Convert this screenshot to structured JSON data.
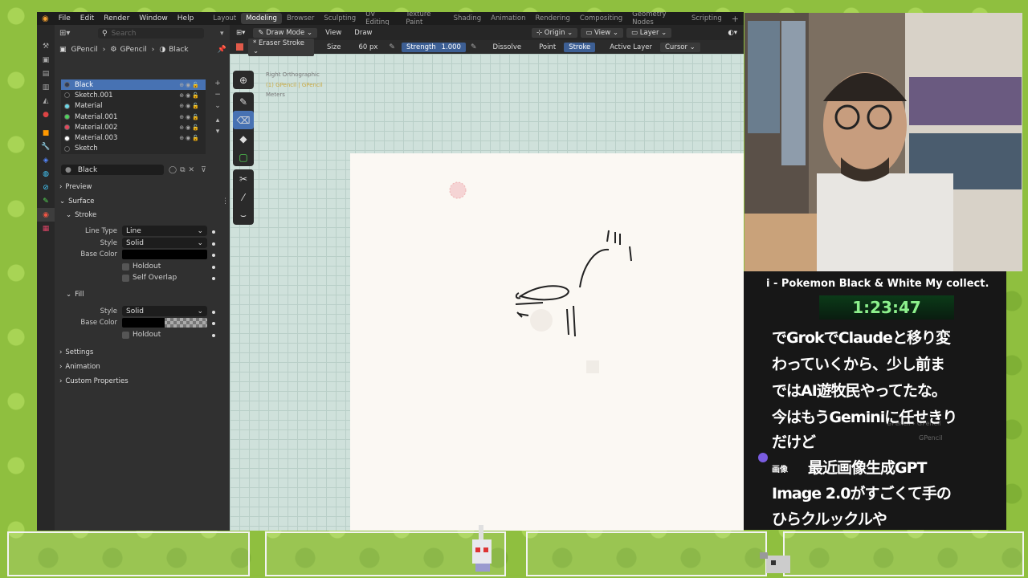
{
  "menu": {
    "file": "File",
    "edit": "Edit",
    "render": "Render",
    "window": "Window",
    "help": "Help"
  },
  "workspaces": [
    "Layout",
    "Modeling",
    "Browser",
    "Sculpting",
    "UV Editing",
    "Texture Paint",
    "Shading",
    "Animation",
    "Rendering",
    "Compositing",
    "Geometry Nodes",
    "Scripting"
  ],
  "props": {
    "search_placeholder": "Search",
    "breadcrumb": [
      "GPencil",
      "GPencil",
      "Black"
    ],
    "materials": [
      {
        "name": "Black",
        "color": "#2e3a55",
        "selected": true
      },
      {
        "name": "Sketch.001",
        "color": "#222222",
        "selected": false
      },
      {
        "name": "Material",
        "color": "#6ad6e6",
        "selected": false
      },
      {
        "name": "Material.001",
        "color": "#4cd45a",
        "selected": false
      },
      {
        "name": "Material.002",
        "color": "#e6465a",
        "selected": false
      },
      {
        "name": "Material.003",
        "color": "#ffffff",
        "selected": false
      },
      {
        "name": "Sketch",
        "color": "#222222",
        "selected": false
      }
    ],
    "material_name": "Black",
    "preview": "Preview",
    "surface": "Surface",
    "stroke": "Stroke",
    "line_type_label": "Line Type",
    "line_type_value": "Line",
    "style_label": "Style",
    "style_value": "Solid",
    "base_color_label": "Base Color",
    "holdout": "Holdout",
    "self_overlap": "Self Overlap",
    "fill": "Fill",
    "fill_style_label": "Style",
    "fill_style_value": "Solid",
    "fill_base_color_label": "Base Color",
    "fill_holdout": "Holdout",
    "settings": "Settings",
    "animation": "Animation",
    "custom_properties": "Custom Properties"
  },
  "viewport": {
    "mode": "Draw Mode",
    "view": "View",
    "draw": "Draw",
    "origin": "Origin",
    "view_dd": "View",
    "layer": "Layer",
    "brush": "Eraser Stroke",
    "size_label": "Size",
    "size_value": "60 px",
    "strength_label": "Strength",
    "strength_value": "1.000",
    "dissolve": "Dissolve",
    "point": "Point",
    "stroke": "Stroke",
    "active_layer": "Active Layer",
    "cursor": "Cursor",
    "info_view": "Right Orthographic",
    "info_obj": "(1) GPencil | GPencil",
    "info_units": "Meters"
  },
  "overlay": {
    "title": "i - Pokemon Black & White My collect.",
    "timer": "1:23:47",
    "subtitles": [
      "でGrokでClaudeと移り変",
      "わっていくから、少し前ま",
      "ではAI遊牧民やってたな。",
      "今はもうGeminiに任せきり",
      "だけど"
    ],
    "user_badge": "画像",
    "user_name": "最近画像生成GPT",
    "subtitles2": [
      "Image 2.0がすごくて手の",
      "ひらクルックルや"
    ],
    "mini_bc1": "GPencil",
    "mini_bc2": "GPencil",
    "mini_item": "GPencil"
  }
}
